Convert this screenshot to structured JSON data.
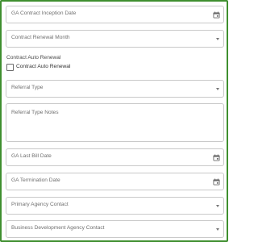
{
  "fields": {
    "ga_contract_inception_date": "GA Contract Inception Date",
    "contract_renewal_month": "Contract Renewal Month",
    "contract_auto_renewal_section": "Contract Auto Renewal",
    "contract_auto_renewal_checkbox": "Contract Auto Renewal",
    "referral_type": "Referral Type",
    "referral_type_notes": "Referral Type Notes",
    "ga_last_bill_date": "GA Last Bill Date",
    "ga_termination_date": "GA Termination Date",
    "primary_agency_contact": "Primary Agency Contact",
    "business_development_agency_contact": "Business Development Agency Contact"
  },
  "checkbox_checked": false,
  "colors": {
    "frame_border": "#3f8f2f",
    "field_border": "#c9c9c9",
    "label_text": "#6f6f6f"
  },
  "icons": {
    "date": "calendar-icon",
    "select": "dropdown-caret-icon"
  }
}
